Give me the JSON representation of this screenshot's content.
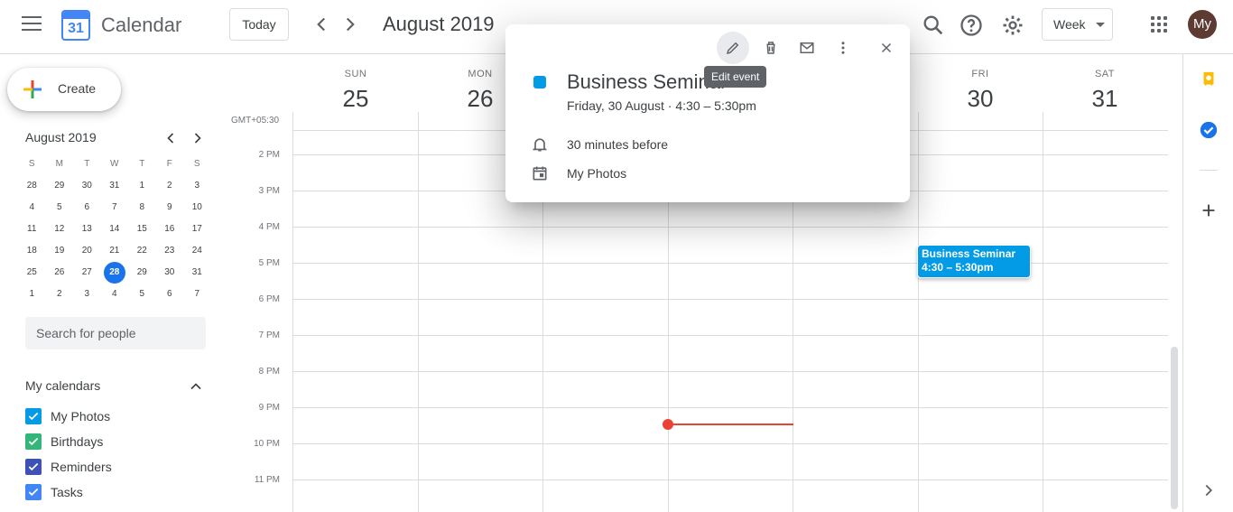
{
  "header": {
    "app_title": "Calendar",
    "logo_day": "31",
    "today_label": "Today",
    "month_title": "August 2019",
    "view_label": "Week",
    "avatar_initials": "My"
  },
  "sidebar": {
    "create_label": "Create",
    "mini_calendar": {
      "title": "August 2019",
      "weekdays": [
        "S",
        "M",
        "T",
        "W",
        "T",
        "F",
        "S"
      ],
      "weeks": [
        [
          "28",
          "29",
          "30",
          "31",
          "1",
          "2",
          "3"
        ],
        [
          "4",
          "5",
          "6",
          "7",
          "8",
          "9",
          "10"
        ],
        [
          "11",
          "12",
          "13",
          "14",
          "15",
          "16",
          "17"
        ],
        [
          "18",
          "19",
          "20",
          "21",
          "22",
          "23",
          "24"
        ],
        [
          "25",
          "26",
          "27",
          "28",
          "29",
          "30",
          "31"
        ],
        [
          "1",
          "2",
          "3",
          "4",
          "5",
          "6",
          "7"
        ]
      ],
      "today": "28"
    },
    "search_placeholder": "Search for people",
    "my_calendars_title": "My calendars",
    "calendars": [
      {
        "label": "My Photos",
        "color": "#039be5"
      },
      {
        "label": "Birthdays",
        "color": "#33b679"
      },
      {
        "label": "Reminders",
        "color": "#3f51b5"
      },
      {
        "label": "Tasks",
        "color": "#4285f4"
      }
    ]
  },
  "week": {
    "timezone": "GMT+05:30",
    "days": [
      {
        "name": "SUN",
        "num": "25"
      },
      {
        "name": "MON",
        "num": "26"
      },
      {
        "name": "FRI",
        "num": "30"
      },
      {
        "name": "SAT",
        "num": "31"
      }
    ],
    "hours": [
      "2 PM",
      "3 PM",
      "4 PM",
      "5 PM",
      "6 PM",
      "7 PM",
      "8 PM",
      "9 PM",
      "10 PM",
      "11 PM"
    ],
    "event_chip": {
      "title": "Business Seminar",
      "time": "4:30 – 5:30pm"
    }
  },
  "popup": {
    "title": "Business Seminar",
    "datetime": "Friday, 30 August  ·  4:30 – 5:30pm",
    "tooltip": "Edit event",
    "reminder": "30 minutes before",
    "calendar": "My Photos",
    "color": "#039be5"
  }
}
